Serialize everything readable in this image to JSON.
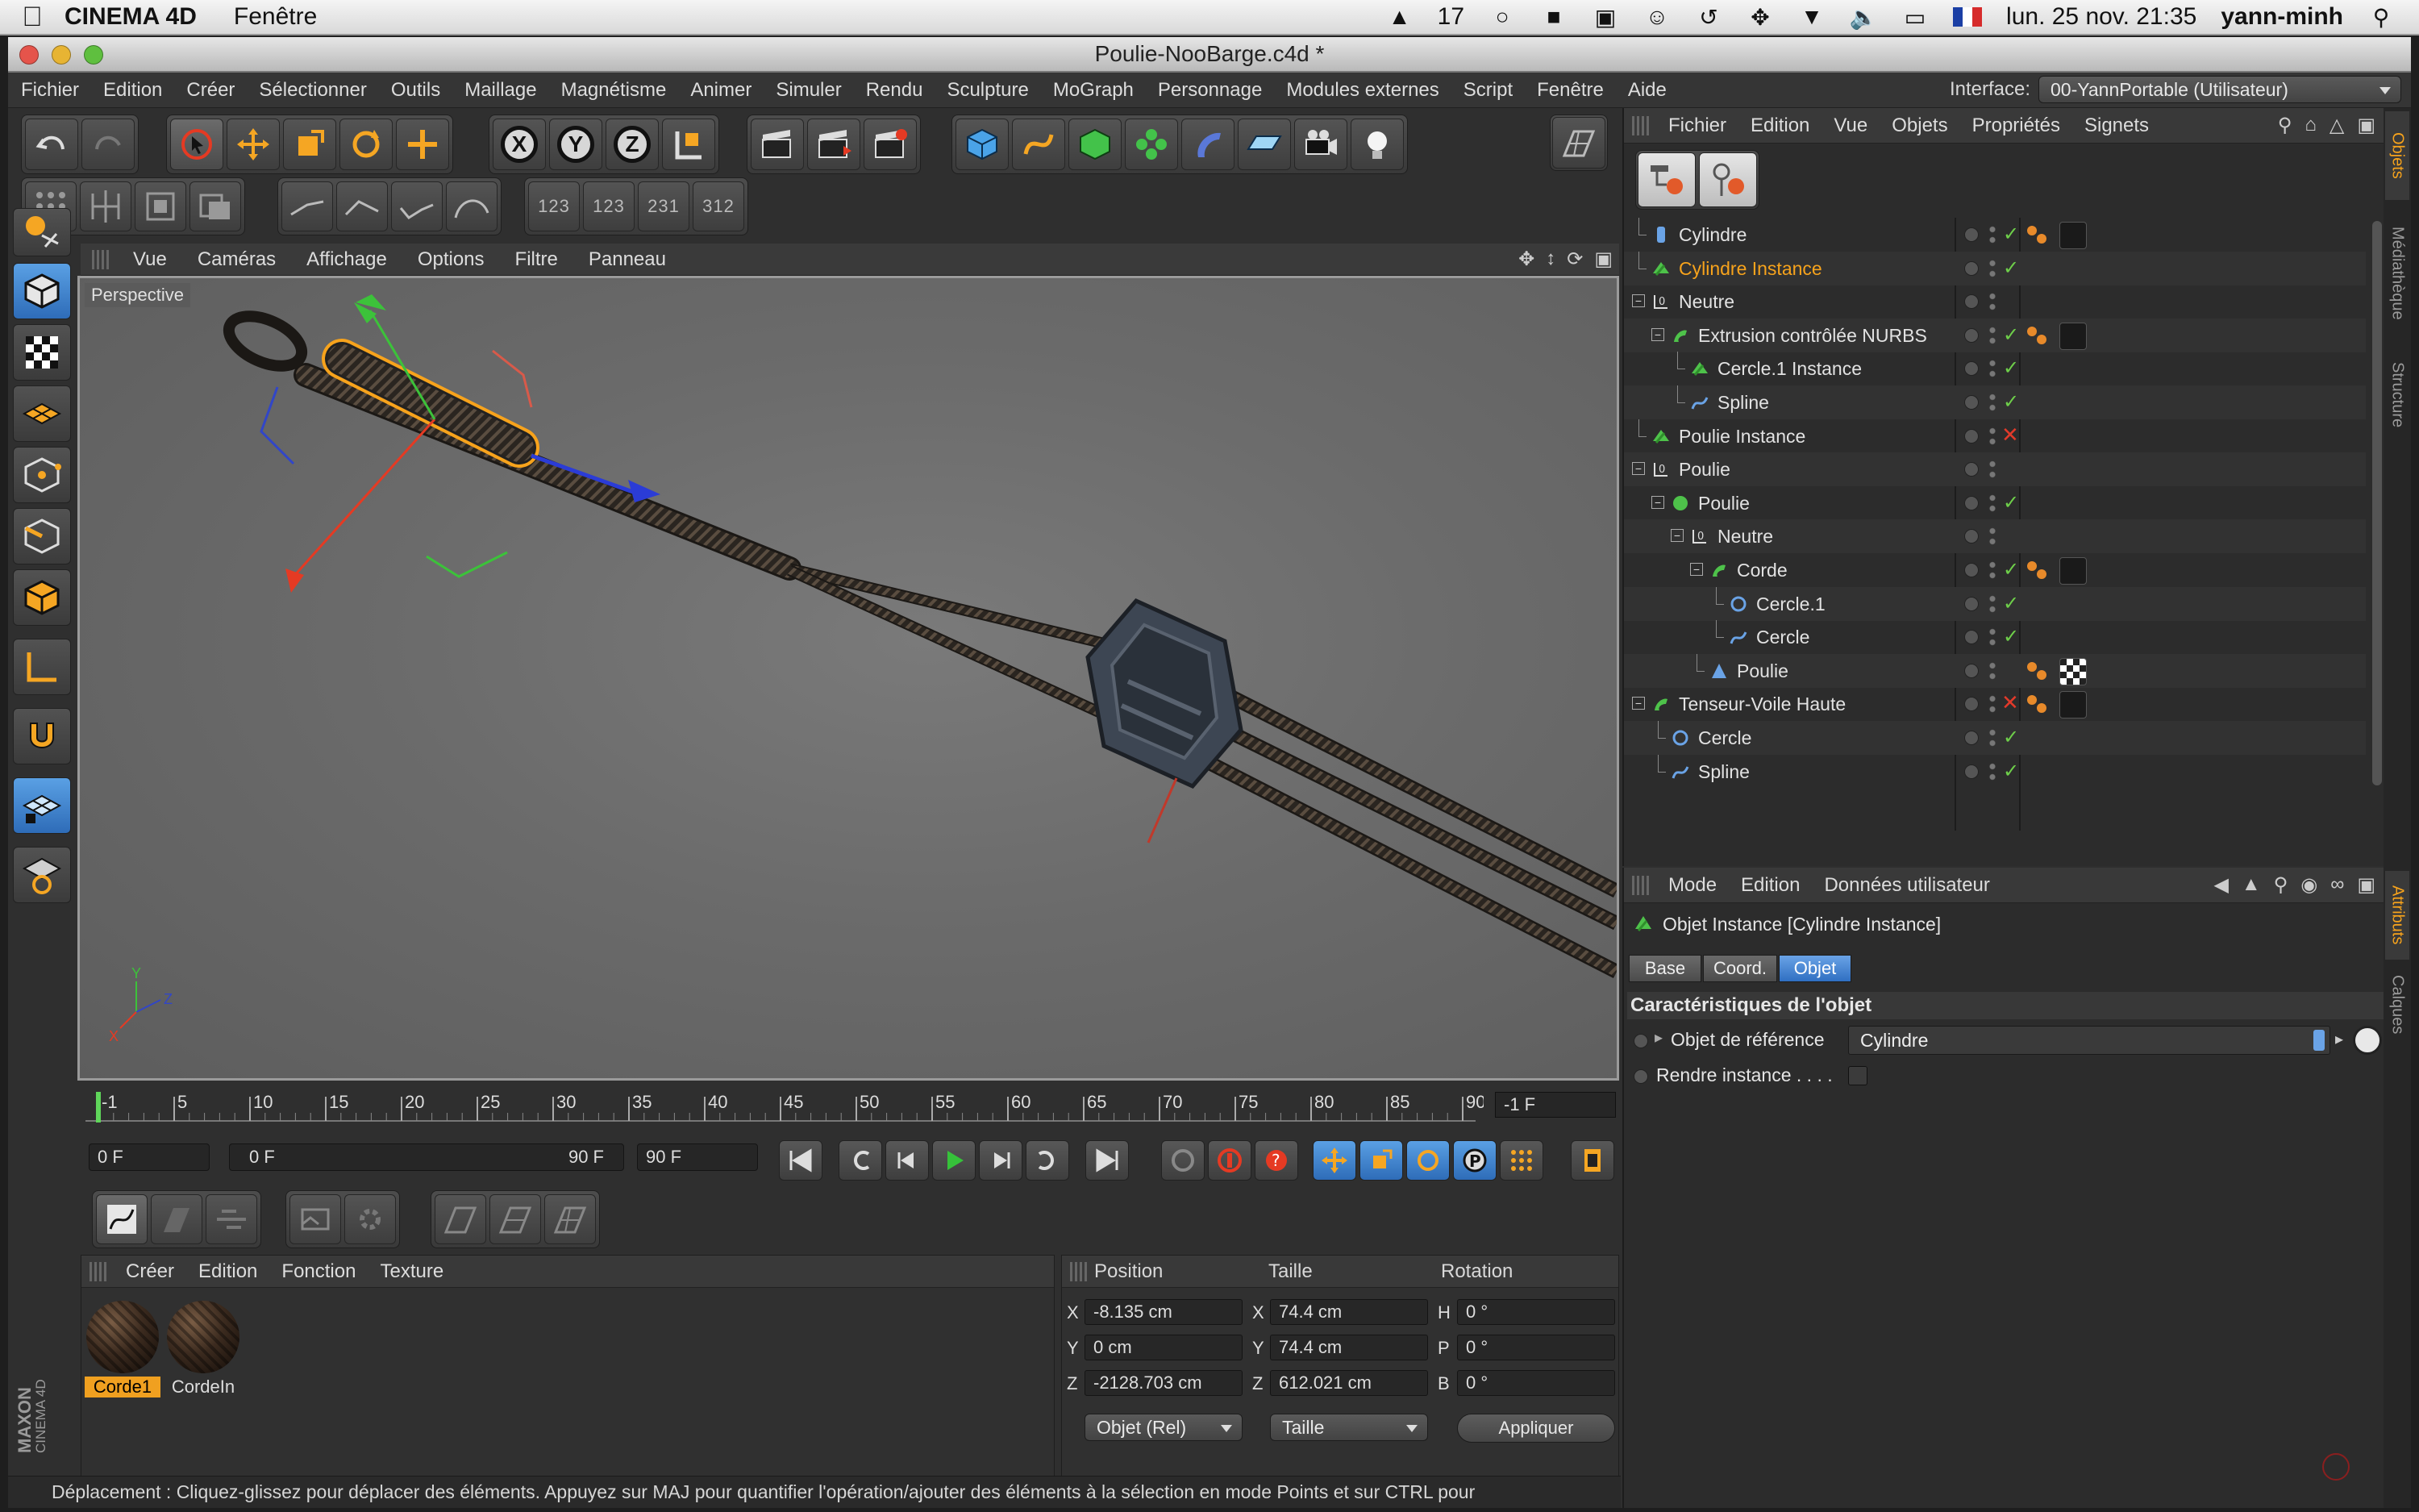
{
  "macbar": {
    "app": "CINEMA 4D",
    "menu": "Fenêtre",
    "badge": "17",
    "datetime": "lun. 25 nov.  21:35",
    "user": "yann-minh"
  },
  "window": {
    "title": "Poulie-NooBarge.c4d *"
  },
  "mainmenu": [
    "Fichier",
    "Edition",
    "Créer",
    "Sélectionner",
    "Outils",
    "Maillage",
    "Magnétisme",
    "Animer",
    "Simuler",
    "Rendu",
    "Sculpture",
    "MoGraph",
    "Personnage",
    "Modules externes",
    "Script",
    "Fenêtre",
    "Aide"
  ],
  "interface": {
    "label": "Interface:",
    "value": "00-YannPortable (Utilisateur)"
  },
  "toolbar": {
    "groups_numbers": [
      "123",
      "123",
      "231",
      "312"
    ]
  },
  "viewport": {
    "menu": [
      "Vue",
      "Caméras",
      "Affichage",
      "Options",
      "Filtre",
      "Panneau"
    ],
    "label": "Perspective",
    "axis_labels": {
      "y": "Y",
      "x": "X",
      "z": "Z"
    }
  },
  "timeline": {
    "ticks": [
      "-1",
      "5",
      "10",
      "15",
      "20",
      "25",
      "30",
      "35",
      "40",
      "45",
      "50",
      "55",
      "60",
      "65",
      "70",
      "75",
      "80",
      "85",
      "90"
    ],
    "current": "-1 F"
  },
  "transport": {
    "start": "0 F",
    "range_start": "0 F",
    "range_end": "90 F",
    "end": "90 F"
  },
  "materials": {
    "menu": [
      "Créer",
      "Edition",
      "Fonction",
      "Texture"
    ],
    "items": [
      {
        "label": "Corde1",
        "selected": true
      },
      {
        "label": "CordeIn",
        "selected": false
      }
    ]
  },
  "coords": {
    "headers": {
      "position": "Position",
      "size": "Taille",
      "rotation": "Rotation"
    },
    "pos": {
      "x": "-8.135 cm",
      "y": "0 cm",
      "z": "-2128.703 cm"
    },
    "size": {
      "x": "74.4 cm",
      "y": "74.4 cm",
      "z": "612.021 cm"
    },
    "rot": {
      "h": "0 °",
      "p": "0 °",
      "b": "0 °"
    },
    "axis": {
      "x": "X",
      "y": "Y",
      "z": "Z",
      "h": "H",
      "p": "P",
      "b": "B"
    },
    "mode": "Objet (Rel)",
    "sizemode": "Taille",
    "apply": "Appliquer"
  },
  "objects": {
    "menu": [
      "Fichier",
      "Edition",
      "Vue",
      "Objets",
      "Propriétés",
      "Signets"
    ],
    "rows": [
      {
        "name": "Cylindre",
        "indent": 0,
        "icon": "cylinder-icon",
        "status": "check",
        "tags": "material",
        "selected": false
      },
      {
        "name": "Cylindre Instance",
        "indent": 0,
        "icon": "instance-icon",
        "status": "check",
        "tags": "",
        "selected": true
      },
      {
        "name": "Neutre",
        "indent": 0,
        "icon": "null-icon",
        "status": "",
        "tags": "",
        "selected": false,
        "expander": true
      },
      {
        "name": "Extrusion contrôlée NURBS",
        "indent": 1,
        "icon": "sweep-icon",
        "status": "check",
        "tags": "material",
        "selected": false,
        "expander": true
      },
      {
        "name": "Cercle.1 Instance",
        "indent": 2,
        "icon": "instance-icon",
        "status": "check",
        "tags": "",
        "selected": false
      },
      {
        "name": "Spline",
        "indent": 2,
        "icon": "spline-icon",
        "status": "check",
        "tags": "",
        "selected": false
      },
      {
        "name": "Poulie Instance",
        "indent": 0,
        "icon": "instance-icon",
        "status": "x",
        "tags": "",
        "selected": false
      },
      {
        "name": "Poulie",
        "indent": 0,
        "icon": "null-icon",
        "status": "",
        "tags": "",
        "selected": false,
        "expander": true
      },
      {
        "name": "Poulie",
        "indent": 1,
        "icon": "sphere-icon",
        "status": "check",
        "tags": "",
        "selected": false,
        "expander": true
      },
      {
        "name": "Neutre",
        "indent": 2,
        "icon": "null-icon",
        "status": "",
        "tags": "",
        "selected": false,
        "expander": true
      },
      {
        "name": "Corde",
        "indent": 3,
        "icon": "sweep-icon",
        "status": "check",
        "tags": "material",
        "selected": false,
        "expander": true
      },
      {
        "name": "Cercle.1",
        "indent": 4,
        "icon": "circle-icon",
        "status": "check",
        "tags": "",
        "selected": false
      },
      {
        "name": "Cercle",
        "indent": 4,
        "icon": "spline-icon",
        "status": "check",
        "tags": "",
        "selected": false
      },
      {
        "name": "Poulie",
        "indent": 3,
        "icon": "polygon-icon",
        "status": "",
        "tags": "checker",
        "selected": false
      },
      {
        "name": "Tenseur-Voile Haute",
        "indent": 0,
        "icon": "sweep-icon",
        "status": "x",
        "tags": "material",
        "selected": false,
        "expander": true
      },
      {
        "name": "Cercle",
        "indent": 1,
        "icon": "circle-icon",
        "status": "check",
        "tags": "",
        "selected": false
      },
      {
        "name": "Spline",
        "indent": 1,
        "icon": "spline-icon",
        "status": "check",
        "tags": "",
        "selected": false
      }
    ]
  },
  "attributes": {
    "menu": [
      "Mode",
      "Edition",
      "Données utilisateur"
    ],
    "object_title": "Objet Instance [Cylindre Instance]",
    "tabs": [
      {
        "label": "Base",
        "active": false
      },
      {
        "label": "Coord.",
        "active": false
      },
      {
        "label": "Objet",
        "active": true
      }
    ],
    "section": "Caractéristiques de l'objet",
    "ref_label": "Objet de référence",
    "ref_value": "Cylindre",
    "render_label": "Rendre instance . . . ."
  },
  "right_tabs": [
    "Objets",
    "Médiathèque",
    "Structure",
    "Attributs",
    "Calques"
  ],
  "status": "Déplacement : Cliquez-glissez pour déplacer des éléments. Appuyez sur MAJ pour quantifier l'opération/ajouter des éléments à la sélection en mode Points et sur CTRL pour",
  "logo": {
    "maxon": "MAXON",
    "product": "CINEMA 4D"
  },
  "colors": {
    "accent": "#f7a31c",
    "selection_blue": "#2f6fc2",
    "check_green": "#6ecf4a",
    "error_red": "#e23a2a"
  }
}
